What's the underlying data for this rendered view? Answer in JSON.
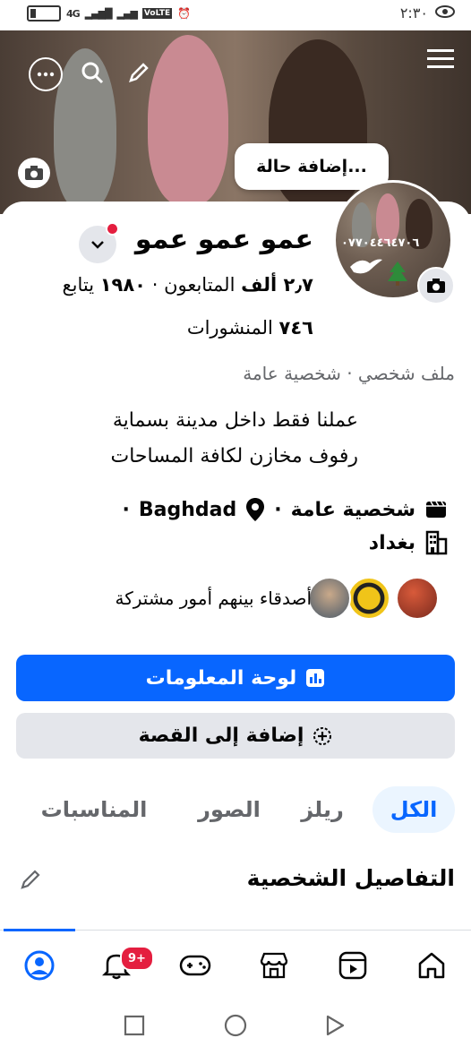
{
  "status_bar": {
    "network": "4G",
    "volte": "VoLTE",
    "time": "٢:٣٠"
  },
  "cover": {
    "add_status_label": "إضافة حالة..."
  },
  "profile": {
    "avatar_phone": "٠٧٧٠٤٤٦٤٧٠٦",
    "name": "عمو عمو عمو",
    "followers_count": "٢٫٧ ألف",
    "followers_label": "المتابعون",
    "following_count": "١٩٨٠",
    "following_label": "يتابع",
    "posts_count": "٧٤٦",
    "posts_label": "المنشورات",
    "category": "ملف شخصي · شخصية عامة",
    "bio_line1": "عملنا فقط داخل مدينة بسماية",
    "bio_line2": "رفوف مخازن لكافة المساحات",
    "info_category": "شخصية عامة",
    "info_location": "Baghdad",
    "info_city": "بغداد",
    "mutual_text": "أصدقاء بينهم أمور مشتركة"
  },
  "buttons": {
    "dashboard": "لوحة المعلومات",
    "add_story": "إضافة إلى القصة"
  },
  "tabs": [
    "الكل",
    "ريلز",
    "الصور",
    "المناسبات"
  ],
  "section": {
    "title": "التفاصيل الشخصية"
  },
  "bottom_nav": {
    "notif_badge": "9+"
  },
  "colors": {
    "primary": "#0866ff",
    "secondary_btn": "#e4e6eb",
    "badge": "#e41e3f"
  },
  "icons": [
    "more-icon",
    "search-icon",
    "edit-icon",
    "menu-icon",
    "camera-icon",
    "chevron-down-icon",
    "video-icon",
    "location-icon",
    "building-icon",
    "dashboard-icon",
    "add-story-icon",
    "profile-nav-icon",
    "bell-icon",
    "gaming-icon",
    "marketplace-icon",
    "video-nav-icon",
    "home-icon"
  ]
}
